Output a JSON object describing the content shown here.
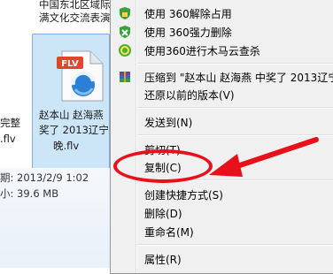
{
  "explorer": {
    "top_folder_line1": "中国东北区域际",
    "top_folder_line2": "满文化交流表演",
    "left_file_line1": "完整",
    "left_file_line2": ".flv",
    "selected_icon_badge": "FLV",
    "selected_file_line1": "赵本山 赵海燕",
    "selected_file_line2": "奖了 2013辽宁",
    "selected_file_line3": "晚.flv",
    "detail_date": "期: 2013/2/9 1:02",
    "detail_size": "小: 39.6 MB"
  },
  "context_menu": {
    "items": [
      {
        "label": "使用 360解除占用",
        "icon": "shield-unlock-icon"
      },
      {
        "label": "使用 360强力删除",
        "icon": "shield-delete-icon"
      },
      {
        "label": "使用360进行木马云查杀",
        "icon": "360-scan-icon"
      },
      {
        "label": "压缩到 \"赵本山 赵海燕 中奖了 2013辽宁",
        "icon": "winrar-icon"
      },
      {
        "label": "还原以前的版本(V)",
        "icon": ""
      },
      {
        "label": "发送到(N)",
        "icon": ""
      },
      {
        "label": "剪切(T)",
        "icon": ""
      },
      {
        "label": "复制(C)",
        "icon": ""
      },
      {
        "label": "创建快捷方式(S)",
        "icon": ""
      },
      {
        "label": "删除(D)",
        "icon": ""
      },
      {
        "label": "重命名(M)",
        "icon": ""
      },
      {
        "label": "属性(R)",
        "icon": ""
      }
    ]
  },
  "annotation": {
    "color": "#e8101a"
  }
}
